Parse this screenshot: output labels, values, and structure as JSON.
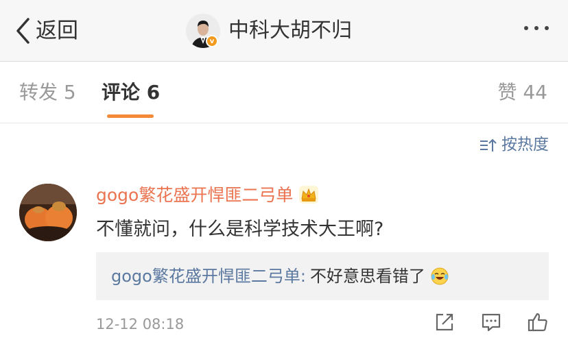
{
  "header": {
    "back_label": "返回",
    "title": "中科大胡不归",
    "verified_badge": "v",
    "icons": [
      "chevron-left-icon",
      "more-icon"
    ]
  },
  "tabs": {
    "repost": "转发 5",
    "comment": "评论 6",
    "like": "赞 44"
  },
  "sort": {
    "label": "按热度",
    "icon": "sort-icon"
  },
  "comment": {
    "user": "gogo繁花盛开悍匪二弓单",
    "text": "不懂就问，什么是科学技术大王啊?",
    "reply_user": "gogo繁花盛开悍匪二弓单",
    "reply_sep": ":",
    "reply_text": "不好意思看错了",
    "time": "12-12 08:18",
    "icons": [
      "crown-icon",
      "laugh-cry-emoji-icon",
      "share-icon",
      "comment-icon",
      "like-icon"
    ]
  },
  "colors": {
    "accent": "#f28a38",
    "username": "#eb7350",
    "link": "#5a78a0"
  }
}
